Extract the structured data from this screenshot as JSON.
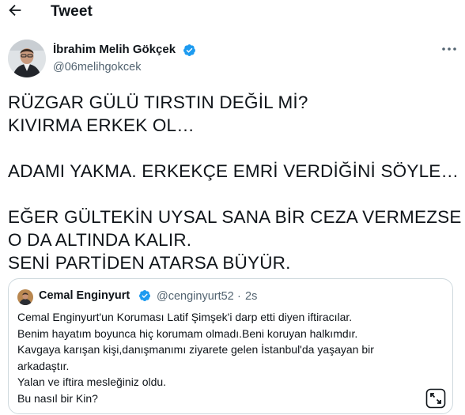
{
  "header": {
    "title": "Tweet",
    "back_icon": "arrow-left-icon"
  },
  "author": {
    "name": "İbrahim Melih Gökçek",
    "handle": "@06melihgokcek",
    "verified_icon": "verified-badge-icon",
    "more_icon": "more-options-icon",
    "verified_color": "#1d9bf0"
  },
  "tweet": {
    "lines": [
      "RÜZGAR GÜLÜ TIRSTIN DEĞİL Mİ?",
      "KIVIRMA ERKEK OL…",
      "ADAMI YAKMA. ERKEKÇE EMRİ VERDİĞİNİ SÖYLE…",
      "EĞER GÜLTEKİN UYSAL SANA BİR CEZA VERMEZSE",
      "O DA ALTINDA KALIR.",
      "SENİ PARTİDEN ATARSA BÜYÜR."
    ]
  },
  "quote": {
    "name": "Cemal Enginyurt",
    "handle": "@cenginyurt52",
    "separator": "·",
    "time": "2s",
    "lines": [
      "Cemal Enginyurt'un Koruması Latif Şimşek'i darp etti diyen iftiracılar.",
      "Benim hayatım boyunca hiç korumam olmadı.Beni koruyan halkımdır.",
      "Kavgaya karışan kişi,danışmanımı ziyarete gelen İstanbul'da yaşayan bir",
      "arkadaştır.",
      "Yalan ve iftira mesleğiniz oldu.",
      "Bu nasıl bir Kin?"
    ],
    "expand_icon": "expand-icon"
  },
  "colors": {
    "text": "#0f1419",
    "secondary": "#536471",
    "border": "#cfd9de",
    "accent": "#1d9bf0"
  }
}
